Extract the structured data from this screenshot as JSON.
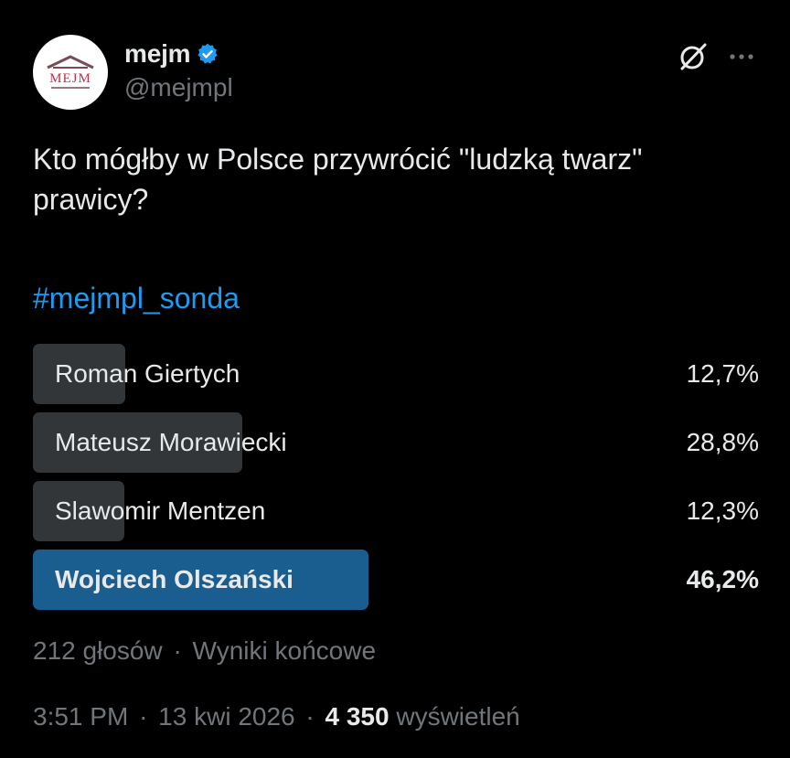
{
  "author": {
    "display_name": "mejm",
    "handle": "@mejmpl",
    "avatar_text": "MEJM",
    "verified_icon": "verified-badge-icon"
  },
  "actions": {
    "grok_icon": "grok-icon",
    "more_icon": "more-options-icon"
  },
  "post": {
    "text": "Kto mógłby w Polsce przywrócić \"ludzką twarz\" prawicy?",
    "hashtag": "#mejmpl_sonda"
  },
  "poll": {
    "options": [
      {
        "label": "Roman Giertych",
        "percent_text": "12,7%",
        "fraction": 0.127
      },
      {
        "label": "Mateusz Morawiecki",
        "percent_text": "28,8%",
        "fraction": 0.288
      },
      {
        "label": "Slawomir Mentzen",
        "percent_text": "12,3%",
        "fraction": 0.123
      },
      {
        "label": "Wojciech Olszański",
        "percent_text": "46,2%",
        "fraction": 0.462,
        "winner": true
      }
    ],
    "votes": "212 głosów",
    "separator": "·",
    "status": "Wyniki końcowe"
  },
  "meta": {
    "time": "3:51 PM",
    "separator": "·",
    "date": "13 kwi 2026",
    "views_count": "4 350",
    "views_label": "wyświetleń"
  },
  "colors": {
    "background": "#000000",
    "text": "#e7e9ea",
    "muted": "#71767b",
    "accent": "#1d9bf0",
    "poll_bar": "#333639",
    "poll_bar_winner": "#1a5d8f"
  }
}
